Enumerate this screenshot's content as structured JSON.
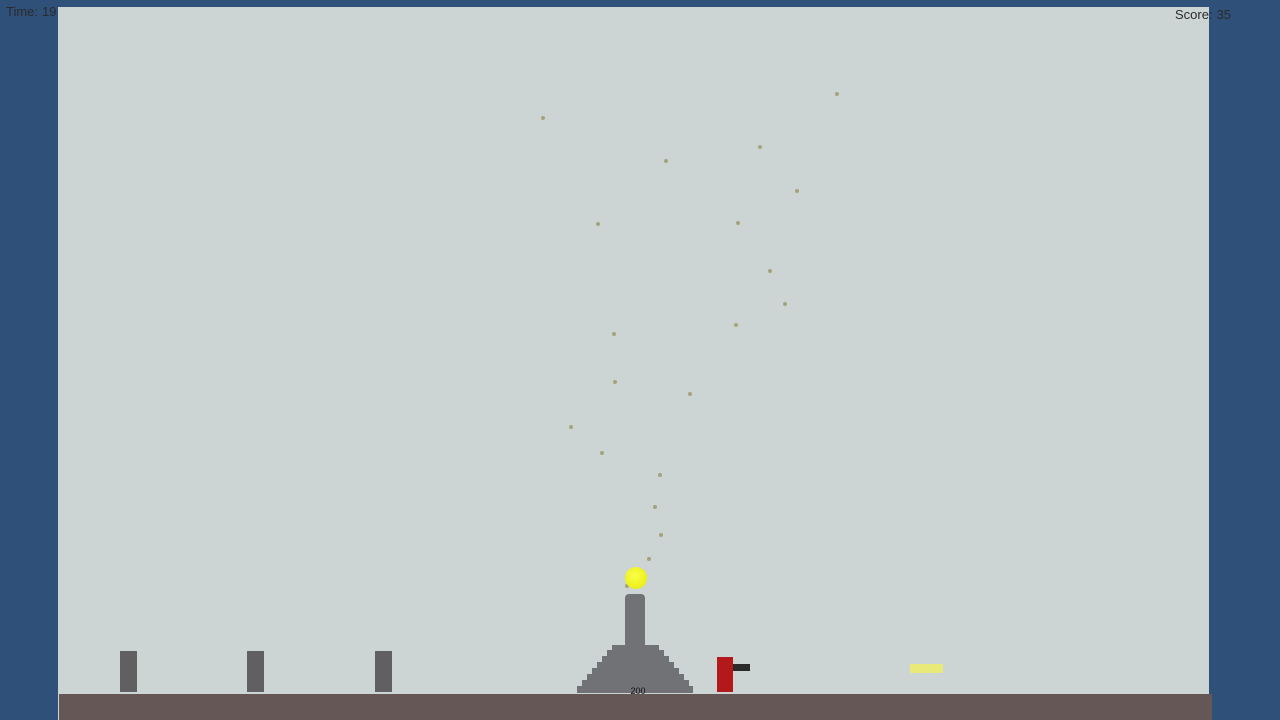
{
  "hud": {
    "time_label": "Time:",
    "time_value": "19",
    "score_label": "Score:",
    "score_value": "35"
  },
  "tower": {
    "label": "200"
  },
  "colors": {
    "frame": "#2f5079",
    "playfield": "#cdd5d4",
    "ground": "#645755",
    "tower": "#707276",
    "pillar": "#606060",
    "enemy": "#b3191b",
    "orb": "#eef21f",
    "pickup": "#e9e97a",
    "particle": "#a4a47a"
  },
  "entities": {
    "pillars": 3,
    "particles": 25
  }
}
